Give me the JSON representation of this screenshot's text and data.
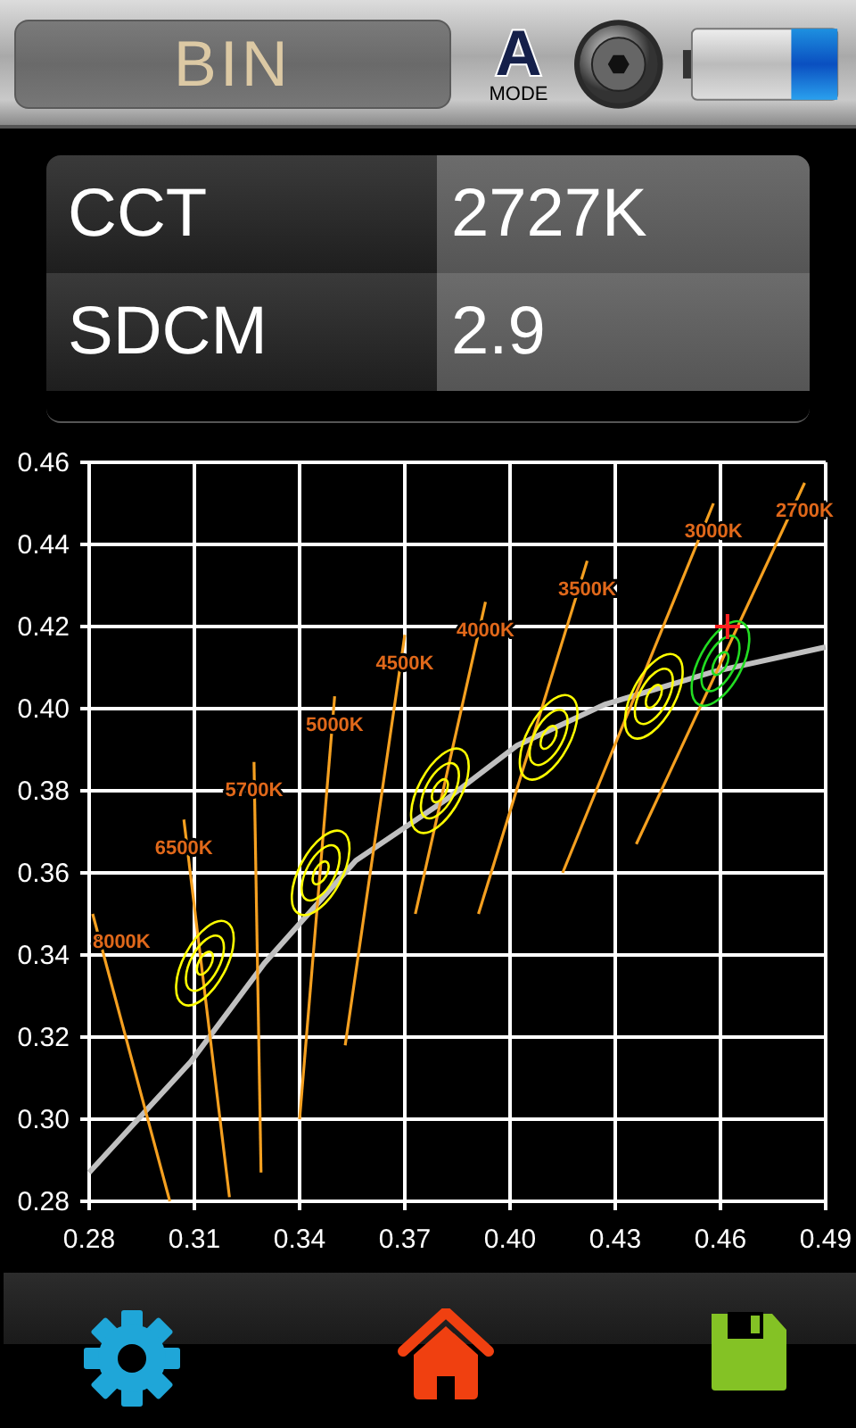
{
  "header": {
    "display": "BIN",
    "mode": {
      "letter": "A",
      "label": "MODE"
    }
  },
  "readings": [
    {
      "label": "CCT",
      "value": "2727K"
    },
    {
      "label": "SDCM",
      "value": "2.9"
    }
  ],
  "chart": {
    "chart_data": {
      "type": "line",
      "grid": true,
      "xlim": [
        0.28,
        0.49
      ],
      "ylim": [
        0.28,
        0.46
      ],
      "xticks": [
        {
          "value": 0.28,
          "label": "0.28"
        },
        {
          "value": 0.31,
          "label": "0.31"
        },
        {
          "value": 0.34,
          "label": "0.34"
        },
        {
          "value": 0.37,
          "label": "0.37"
        },
        {
          "value": 0.4,
          "label": "0.40"
        },
        {
          "value": 0.43,
          "label": "0.43"
        },
        {
          "value": 0.46,
          "label": "0.46"
        },
        {
          "value": 0.49,
          "label": "0.49"
        }
      ],
      "yticks": [
        {
          "value": 0.28,
          "label": "0.28"
        },
        {
          "value": 0.3,
          "label": "0.30"
        },
        {
          "value": 0.32,
          "label": "0.32"
        },
        {
          "value": 0.34,
          "label": "0.34"
        },
        {
          "value": 0.36,
          "label": "0.36"
        },
        {
          "value": 0.38,
          "label": "0.38"
        },
        {
          "value": 0.4,
          "label": "0.40"
        },
        {
          "value": 0.42,
          "label": "0.42"
        },
        {
          "value": 0.44,
          "label": "0.44"
        },
        {
          "value": 0.46,
          "label": "0.46"
        }
      ],
      "series": [
        {
          "type": "line",
          "color": "#c0c0c0",
          "x": [
            0.28,
            0.309,
            0.33,
            0.356,
            0.382,
            0.402,
            0.427,
            0.458,
            0.49
          ],
          "values": [
            0.287,
            0.314,
            0.338,
            0.363,
            0.378,
            0.391,
            0.401,
            0.409,
            0.415
          ]
        },
        {
          "type": "line",
          "color": "#f5a020",
          "x": [
            0.303,
            0.281
          ],
          "values": [
            0.28,
            0.35
          ]
        },
        {
          "type": "line",
          "color": "#f5a020",
          "x": [
            0.32,
            0.307
          ],
          "values": [
            0.281,
            0.373
          ]
        },
        {
          "type": "line",
          "color": "#f5a020",
          "x": [
            0.329,
            0.327
          ],
          "values": [
            0.287,
            0.387
          ]
        },
        {
          "type": "line",
          "color": "#f5a020",
          "x": [
            0.34,
            0.35
          ],
          "values": [
            0.3,
            0.403
          ]
        },
        {
          "type": "line",
          "color": "#f5a020",
          "x": [
            0.353,
            0.37
          ],
          "values": [
            0.318,
            0.418
          ]
        },
        {
          "type": "line",
          "color": "#f5a020",
          "x": [
            0.373,
            0.393
          ],
          "values": [
            0.35,
            0.426
          ]
        },
        {
          "type": "line",
          "color": "#f5a020",
          "x": [
            0.391,
            0.422
          ],
          "values": [
            0.35,
            0.436
          ]
        },
        {
          "type": "line",
          "color": "#f5a020",
          "x": [
            0.415,
            0.458
          ],
          "values": [
            0.36,
            0.45
          ]
        },
        {
          "type": "line",
          "color": "#f5a020",
          "x": [
            0.436,
            0.484
          ],
          "values": [
            0.367,
            0.455
          ]
        },
        {
          "type": "scatter",
          "color": "#ffff00",
          "x": [
            0.313,
            0.346,
            0.38,
            0.411,
            0.441
          ],
          "values": [
            0.338,
            0.36,
            0.38,
            0.393,
            0.403
          ]
        },
        {
          "type": "scatter",
          "color": "#22dd22",
          "x": [
            0.46
          ],
          "values": [
            0.411
          ]
        },
        {
          "type": "scatter",
          "marker": "cross",
          "color": "#ff2020",
          "x": [
            0.462
          ],
          "values": [
            0.42
          ]
        }
      ],
      "annotations": [
        "8000K",
        "6500K",
        "5700K",
        "5000K",
        "4500K",
        "4000K",
        "3500K",
        "3000K",
        "2700K"
      ]
    }
  },
  "nav": [
    {
      "kind": "settings"
    },
    {
      "kind": "home"
    },
    {
      "kind": "save"
    }
  ]
}
